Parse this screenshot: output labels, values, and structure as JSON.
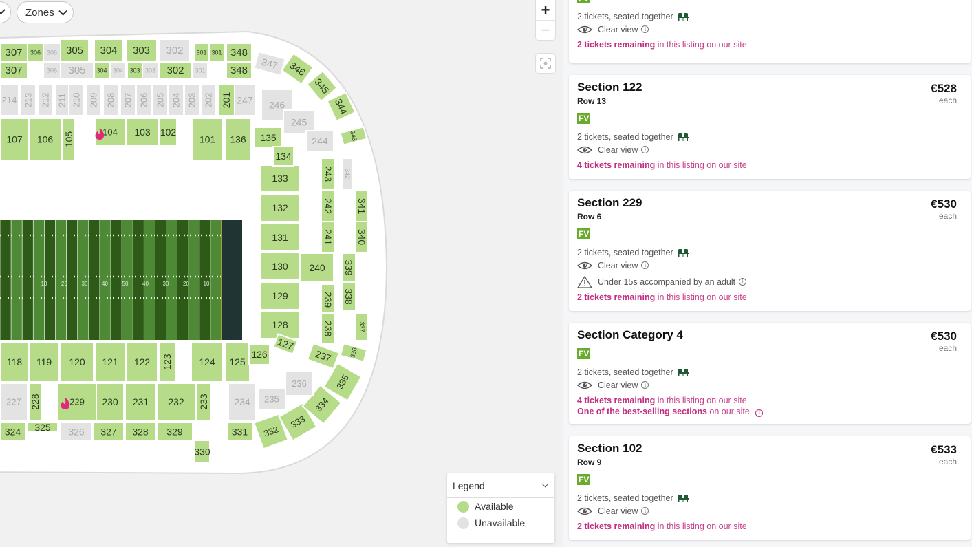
{
  "filters": {
    "partial_pill_label": "",
    "zones_label": "Zones"
  },
  "map_controls": {
    "zoom_in": "+",
    "zoom_out": "−"
  },
  "legend": {
    "title": "Legend",
    "items": [
      {
        "label": "Available",
        "color": "#b6dc8a"
      },
      {
        "label": "Unavailable",
        "color": "#e2e2e2"
      }
    ]
  },
  "colors": {
    "available": "#b6dc8a",
    "unavailable": "#e3e3e3",
    "field_dark": "#2d5a17",
    "field_light": "#4e8a35",
    "endzone": "#213434",
    "hot_icon": "#e0287a",
    "accent_pink": "#c22d7f",
    "fv_badge": "#6aab2e"
  },
  "field": {
    "yard_numbers": [
      "10",
      "20",
      "30",
      "40",
      "50",
      "40",
      "30",
      "20",
      "10"
    ]
  },
  "stadium": {
    "hot_sections": [
      "104",
      "229"
    ],
    "sections": [
      {
        "id": "307",
        "status": "available"
      },
      {
        "id": "306",
        "status": "available"
      },
      {
        "id": "306b",
        "label": "306",
        "status": "unavailable"
      },
      {
        "id": "305",
        "status": "available"
      },
      {
        "id": "304",
        "status": "available"
      },
      {
        "id": "303",
        "status": "available"
      },
      {
        "id": "302",
        "status": "unavailable"
      },
      {
        "id": "301",
        "status": "available"
      },
      {
        "id": "301b",
        "label": "301",
        "status": "available"
      },
      {
        "id": "348",
        "status": "available"
      },
      {
        "id": "307r2",
        "label": "307",
        "status": "available"
      },
      {
        "id": "306r2",
        "label": "306",
        "status": "unavailable"
      },
      {
        "id": "305r2",
        "label": "305",
        "status": "unavailable"
      },
      {
        "id": "304r2",
        "label": "304",
        "status": "available"
      },
      {
        "id": "304r2b",
        "label": "304",
        "status": "unavailable"
      },
      {
        "id": "303r2",
        "label": "303",
        "status": "available"
      },
      {
        "id": "303r2b",
        "label": "303",
        "status": "unavailable"
      },
      {
        "id": "302r2",
        "label": "302",
        "status": "available"
      },
      {
        "id": "301r2",
        "label": "301",
        "status": "unavailable"
      },
      {
        "id": "348r2",
        "label": "348",
        "status": "available"
      },
      {
        "id": "347",
        "status": "unavailable"
      },
      {
        "id": "347r2",
        "label": "347",
        "status": "available"
      },
      {
        "id": "346",
        "status": "available"
      },
      {
        "id": "346r2",
        "label": "346",
        "status": "available"
      },
      {
        "id": "345",
        "status": "available"
      },
      {
        "id": "345r2",
        "label": "345",
        "status": "available"
      },
      {
        "id": "344",
        "status": "available"
      },
      {
        "id": "344r2",
        "label": "344",
        "status": "available"
      },
      {
        "id": "343",
        "status": "available"
      },
      {
        "id": "343r2",
        "label": "343",
        "status": "unavailable"
      },
      {
        "id": "214",
        "status": "unavailable"
      },
      {
        "id": "213",
        "status": "unavailable"
      },
      {
        "id": "212",
        "status": "unavailable"
      },
      {
        "id": "211",
        "status": "unavailable"
      },
      {
        "id": "210",
        "status": "unavailable"
      },
      {
        "id": "209",
        "status": "unavailable"
      },
      {
        "id": "208",
        "status": "unavailable"
      },
      {
        "id": "207",
        "status": "unavailable"
      },
      {
        "id": "206",
        "status": "unavailable"
      },
      {
        "id": "205",
        "status": "unavailable"
      },
      {
        "id": "204",
        "status": "unavailable"
      },
      {
        "id": "203",
        "status": "unavailable"
      },
      {
        "id": "202",
        "status": "unavailable"
      },
      {
        "id": "201",
        "status": "available"
      },
      {
        "id": "247",
        "status": "unavailable"
      },
      {
        "id": "246",
        "status": "unavailable"
      },
      {
        "id": "245",
        "status": "unavailable"
      },
      {
        "id": "244",
        "status": "unavailable"
      },
      {
        "id": "107",
        "status": "available"
      },
      {
        "id": "106",
        "status": "available"
      },
      {
        "id": "105",
        "status": "available"
      },
      {
        "id": "104",
        "status": "available"
      },
      {
        "id": "103",
        "status": "available"
      },
      {
        "id": "102",
        "status": "available"
      },
      {
        "id": "101",
        "status": "available"
      },
      {
        "id": "136",
        "status": "available"
      },
      {
        "id": "135",
        "status": "available"
      },
      {
        "id": "134",
        "status": "available"
      },
      {
        "id": "133",
        "status": "available"
      },
      {
        "id": "132",
        "status": "available"
      },
      {
        "id": "131",
        "status": "available"
      },
      {
        "id": "130",
        "status": "available"
      },
      {
        "id": "129",
        "status": "available"
      },
      {
        "id": "128",
        "status": "available"
      },
      {
        "id": "127",
        "status": "available"
      },
      {
        "id": "126",
        "status": "available"
      },
      {
        "id": "125",
        "status": "available"
      },
      {
        "id": "124",
        "status": "available"
      },
      {
        "id": "123",
        "status": "available"
      },
      {
        "id": "122",
        "status": "available"
      },
      {
        "id": "121",
        "status": "available"
      },
      {
        "id": "120",
        "status": "available"
      },
      {
        "id": "119",
        "status": "available"
      },
      {
        "id": "118",
        "status": "available"
      },
      {
        "id": "243",
        "status": "available"
      },
      {
        "id": "242",
        "status": "available"
      },
      {
        "id": "241",
        "status": "available"
      },
      {
        "id": "240",
        "status": "available"
      },
      {
        "id": "239",
        "status": "available"
      },
      {
        "id": "238",
        "status": "available"
      },
      {
        "id": "237",
        "status": "available"
      },
      {
        "id": "236",
        "status": "unavailable"
      },
      {
        "id": "235",
        "status": "unavailable"
      },
      {
        "id": "234",
        "status": "unavailable"
      },
      {
        "id": "233",
        "status": "available"
      },
      {
        "id": "232",
        "status": "available"
      },
      {
        "id": "231",
        "status": "available"
      },
      {
        "id": "230",
        "status": "available"
      },
      {
        "id": "229",
        "status": "available"
      },
      {
        "id": "228",
        "status": "available"
      },
      {
        "id": "227",
        "status": "unavailable"
      },
      {
        "id": "342",
        "status": "unavailable"
      },
      {
        "id": "341",
        "status": "available"
      },
      {
        "id": "340",
        "status": "available"
      },
      {
        "id": "339",
        "status": "available"
      },
      {
        "id": "338",
        "status": "available"
      },
      {
        "id": "337",
        "status": "available"
      },
      {
        "id": "336",
        "status": "available"
      },
      {
        "id": "335",
        "status": "available"
      },
      {
        "id": "334",
        "status": "available"
      },
      {
        "id": "333",
        "status": "available"
      },
      {
        "id": "332",
        "status": "available"
      },
      {
        "id": "331",
        "status": "available"
      },
      {
        "id": "330",
        "status": "available"
      },
      {
        "id": "329",
        "status": "available"
      },
      {
        "id": "328",
        "status": "available"
      },
      {
        "id": "327",
        "status": "available"
      },
      {
        "id": "326",
        "status": "unavailable"
      },
      {
        "id": "325",
        "status": "available"
      },
      {
        "id": "324",
        "status": "available"
      }
    ]
  },
  "listings": [
    {
      "title": "",
      "row": "",
      "price": "",
      "each": "",
      "badge": "FV",
      "tickets": "2 tickets, seated together",
      "view": "Clear view",
      "restriction": "",
      "remaining_bold": "2 tickets remaining",
      "remaining_rest": " in this listing on our site",
      "bestseller_bold": "",
      "bestseller_rest": ""
    },
    {
      "title": "Section 122",
      "row": "Row 13",
      "price": "€528",
      "each": "each",
      "badge": "FV",
      "tickets": "2 tickets, seated together",
      "view": "Clear view",
      "restriction": "",
      "remaining_bold": "4 tickets remaining",
      "remaining_rest": " in this listing on our site",
      "bestseller_bold": "",
      "bestseller_rest": ""
    },
    {
      "title": "Section 229",
      "row": "Row 6",
      "price": "€530",
      "each": "each",
      "badge": "FV",
      "tickets": "2 tickets, seated together",
      "view": "Clear view",
      "restriction": "Under 15s accompanied by an adult",
      "remaining_bold": "2 tickets remaining",
      "remaining_rest": " in this listing on our site",
      "bestseller_bold": "",
      "bestseller_rest": ""
    },
    {
      "title": "Section Category 4",
      "row": "",
      "price": "€530",
      "each": "each",
      "badge": "FV",
      "tickets": "2 tickets, seated together",
      "view": "Clear view",
      "restriction": "",
      "remaining_bold": "4 tickets remaining",
      "remaining_rest": " in this listing on our site",
      "bestseller_bold": "One of the best-selling sections",
      "bestseller_rest": " on our site"
    },
    {
      "title": "Section 102",
      "row": "Row 9",
      "price": "€533",
      "each": "each",
      "badge": "FV",
      "tickets": "2 tickets, seated together",
      "view": "Clear view",
      "restriction": "",
      "remaining_bold": "2 tickets remaining",
      "remaining_rest": " in this listing on our site",
      "bestseller_bold": "",
      "bestseller_rest": ""
    }
  ]
}
